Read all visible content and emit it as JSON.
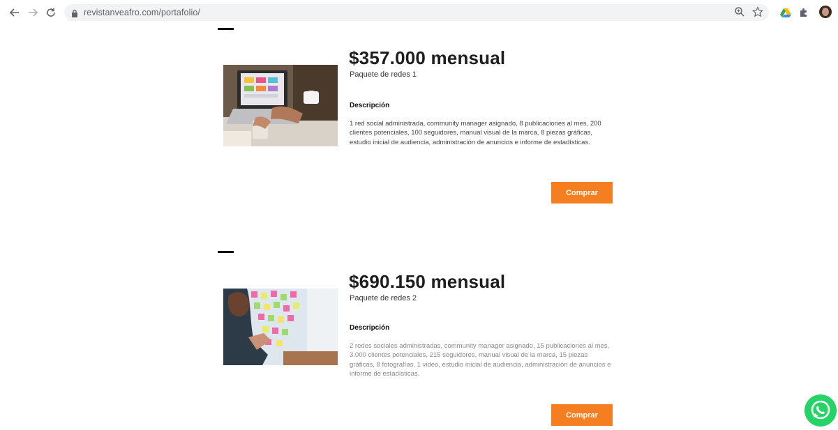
{
  "browser": {
    "url": "revistanveafro.com/portafolio/"
  },
  "products": [
    {
      "price": "$357.000 mensual",
      "package": "Paquete de redes 1",
      "description_heading": "Descripción",
      "description": "1 red social administrada, community manager asignado, 8 publicaciones al mes, 200 clientes potenciales, 100 seguidores, manual visual de la marca, 8 piezas gráficas, estudio inicial de audiencia, administración de anuncios e informe de estadísticas.",
      "button": "Comprar"
    },
    {
      "price": "$690.150 mensual",
      "package": "Paquete de redes 2",
      "description_heading": "Descripción",
      "description": "2 redes sociales administradas, community manager asignado, 15 publicaciones al mes, 3.000 clientes potenciales, 215 seguidores, manual visual de la marca, 15 piezas gráficas, 8 fotografías, 1 video, estudio inicial de audiencia, administración de anuncios e informe de estadísticas.",
      "button": "Comprar"
    }
  ],
  "colors": {
    "accent": "#f57f20",
    "whatsapp": "#25d366"
  }
}
